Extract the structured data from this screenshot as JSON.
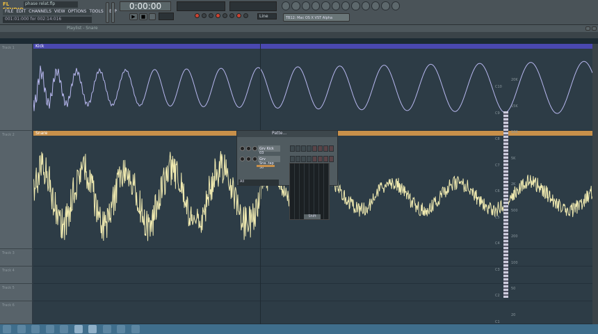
{
  "app": {
    "logo": "FL STUDIO",
    "project": "phase relat.flp",
    "menu": [
      "FILE",
      "EDIT",
      "CHANNELS",
      "VIEW",
      "OPTIONS",
      "TOOLS",
      "HELP"
    ],
    "hint": "001:01:000 for 002:14:016",
    "clock": "0:00:00",
    "snap": "Line",
    "plugin": "TB12: Mac OS X VST Alpha"
  },
  "playlist": {
    "title": "Playlist - Snare",
    "tracks": [
      "Track 1",
      "Track 2",
      "Track 3",
      "Track 4",
      "Track 5",
      "Track 6"
    ],
    "clips": [
      {
        "name": "Kick",
        "color": "#4a48b0",
        "wave": "#b8b8f0"
      },
      {
        "name": "Snare",
        "color": "#c8904a",
        "wave": "#f0eab0"
      }
    ]
  },
  "channel_rack": {
    "title": "Patte...",
    "channels": [
      "Grv Kick 03",
      "Grv Sna..tap 30"
    ],
    "filter": "All",
    "shift": "Shift"
  },
  "analyzer": {
    "notes": [
      "C10",
      "C9",
      "C8",
      "C7",
      "C6",
      "C5",
      "C4",
      "C3",
      "C2",
      "C1"
    ],
    "freqs": [
      "20K",
      "15K",
      "10K",
      "5K",
      "2K",
      "500",
      "200",
      "100",
      "50",
      "20"
    ]
  },
  "taskbar": {
    "icons": [
      "start-icon",
      "ie-icon",
      "explorer-icon",
      "firefox-icon",
      "chrome-icon",
      "flstudio-icon",
      "app-icon",
      "winamp-icon",
      "files-icon",
      "fl-alt-icon"
    ]
  }
}
